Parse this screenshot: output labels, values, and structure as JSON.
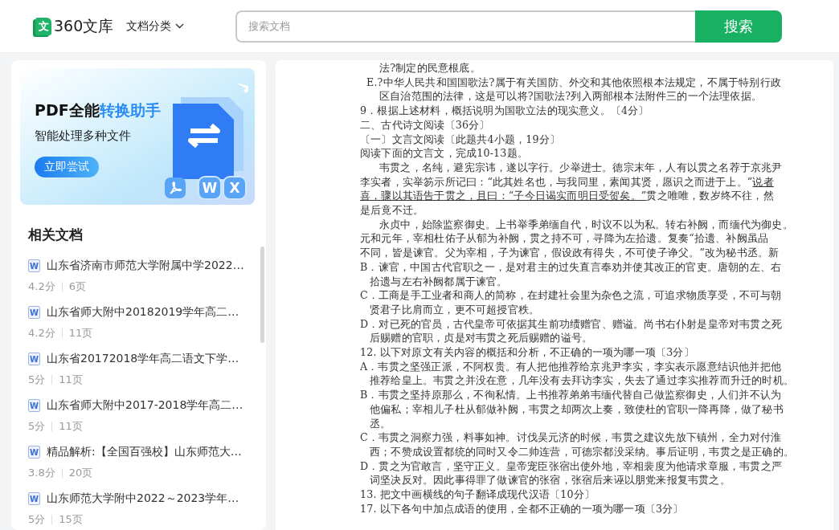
{
  "header": {
    "logo": {
      "mark": "文",
      "name": "360文库"
    },
    "category_menu": "文档分类",
    "search": {
      "placeholder": "搜索文档",
      "button": "搜索"
    }
  },
  "sidebar": {
    "banner": {
      "title_parts": [
        {
          "text": "PDF全能",
          "accent": false
        },
        {
          "text": "转换助手",
          "accent": true
        }
      ],
      "subtitle": "智能处理多种文件",
      "button": "立即尝试",
      "badges": [
        "W",
        "X"
      ]
    },
    "heading": "相关文档",
    "documents": [
      {
        "type": "W",
        "title": "山东省济南市师范大学附属中学2022…",
        "score": "4.2分",
        "pages": "6页"
      },
      {
        "type": "W",
        "title": "山东省师大附中20182019学年高二…",
        "score": "4.2分",
        "pages": "11页"
      },
      {
        "type": "W",
        "title": "山东省20172018学年高二语文下学…",
        "score": "5分",
        "pages": "11页"
      },
      {
        "type": "W",
        "title": "山东省师大附中2017-2018学年高二…",
        "score": "5分",
        "pages": "11页"
      },
      {
        "type": "W",
        "title": "精品解析:【全国百强校】山东师范大…",
        "score": "3.8分",
        "pages": "20页"
      },
      {
        "type": "W",
        "title": "山东师范大学附中2022～2023学年…",
        "score": "5分",
        "pages": "15页"
      }
    ]
  },
  "document": {
    "lines": [
      {
        "kind": "deep",
        "text": "法?制定的民意根底。"
      },
      {
        "kind": "half",
        "text": "E.?中华人民共和国国歌法?属于有关国防、外交和其他依照根本法规定，不属于特别行政"
      },
      {
        "kind": "deep",
        "text": "区自治范围的法律，这是可以将?国歌法?列入两部根本法附件三的一个法理依据。"
      },
      {
        "kind": "plain",
        "text": "9．根据上述材料，概括说明为国歌立法的现实意义。〔4分〕"
      },
      {
        "kind": "plain",
        "text": "二、古代诗文阅读〔36分〕"
      },
      {
        "kind": "plain",
        "text": "〔一〕文言文阅读〔此题共4小题，19分〕"
      },
      {
        "kind": "plain",
        "text": "阅读下面的文言文，完成10-13题。"
      },
      {
        "kind": "para",
        "text": "韦贯之，名纯，避宪宗讳，遂以字行。少举进士。德宗末年，人有以贯之名荐于京兆尹"
      },
      {
        "kind": "plain",
        "segments": [
          {
            "text": "李实者，实举笏示所记曰：“此其姓名也，与我同里，素闻其贤，愿识之而进于上。”",
            "underlined": false
          },
          {
            "text": "说者",
            "underlined": true
          }
        ]
      },
      {
        "kind": "plain",
        "segments": [
          {
            "text": "喜，骤以其语告于贯之，且曰：“子今日谒实而明日受贺矣。”",
            "underlined": true
          },
          {
            "text": "贯之唯唯，数岁终不往，然",
            "underlined": false
          }
        ]
      },
      {
        "kind": "plain",
        "text": "是后竟不迁。"
      },
      {
        "kind": "para",
        "text": "永贞中，始除监察御史。上书举季弟缅自代，时议不以为私。转右补阙，而缅代为御史。"
      },
      {
        "kind": "plain",
        "text": "元和元年，宰相杜佑子从郁为补阙，贯之持不可，寻降为左拾遗。复奏“拾遗、补阙虽品"
      },
      {
        "kind": "plain",
        "text": "不同，皆是谏官。父为宰相，子为谏官，假设政有得失，不可使子诤父。”改为秘书丞。新"
      },
      {
        "kind": "plain",
        "text": "B．谏官，中国古代官职之一，是对君主的过失直言奉劝并使其改正的官吏。唐朝的左、右"
      },
      {
        "kind": "hang",
        "text": "拾遗与左右补阙都属于谏官。"
      },
      {
        "kind": "plain",
        "text": "C．工商是手工业者和商人的简称，在封建社会里为杂色之流，可追求物质享受，不可与朝"
      },
      {
        "kind": "hang",
        "text": "贤君子比肩而立，更不可超授官秩。"
      },
      {
        "kind": "plain",
        "text": "D．对已死的官员，古代皇帝可依据其生前功绩赠官、赠谥。尚书右仆射是皇帝对韦贯之死"
      },
      {
        "kind": "hang",
        "text": "后赐赠的官职，贞是对韦贯之死后赐赠的谥号。"
      },
      {
        "kind": "plain",
        "text": "12. 以下对原文有关内容的概括和分析，不正确的一项为哪一项〔3分〕"
      },
      {
        "kind": "plain",
        "text": "A．韦贯之坚强正派，不阿权贵。有人把他推荐给京兆尹李实，李实表示愿意结识他并把他"
      },
      {
        "kind": "hang",
        "text": "推荐给皇上。韦贯之并没在意，几年没有去拜访李实，失去了通过李实推荐而升迁的时机。"
      },
      {
        "kind": "plain",
        "text": "B．韦贯之坚持原那么，不徇私情。上书推荐弟弟韦缅代替自己做监察御史，人们并不认为"
      },
      {
        "kind": "hang",
        "text": "他偏私；宰相儿子杜从郁做补阙，韦贯之却两次上奏，致使杜的官职一降再降，做了秘书"
      },
      {
        "kind": "hang",
        "text": "丞。"
      },
      {
        "kind": "plain",
        "text": "C．韦贯之洞察力强，料事如神。讨伐吴元济的时候，韦贯之建议先放下镇州，全力对付淮"
      },
      {
        "kind": "hang",
        "text": "西；不赞成设置都统的同时又令二帅连营，可德宗都没采纳。事后证明，韦贯之是正确的。"
      },
      {
        "kind": "plain",
        "text": "D．贯之为官敢言，坚守正义。皇帝宠臣张宿出使外地，宰相裴度为他请求章服，韦贯之严"
      },
      {
        "kind": "hang",
        "text": "词坚决反对。因此事得罪了做谏官的张宿，张宿后来诬以朋党来报复韦贯之。"
      },
      {
        "kind": "plain",
        "text": "13. 把文中画横线的句子翻译成现代汉语〔10分〕"
      },
      {
        "kind": "plain",
        "text": "17. 以下各句中加点成语的使用，全都不正确的一项为哪一项〔3分〕"
      }
    ]
  }
}
